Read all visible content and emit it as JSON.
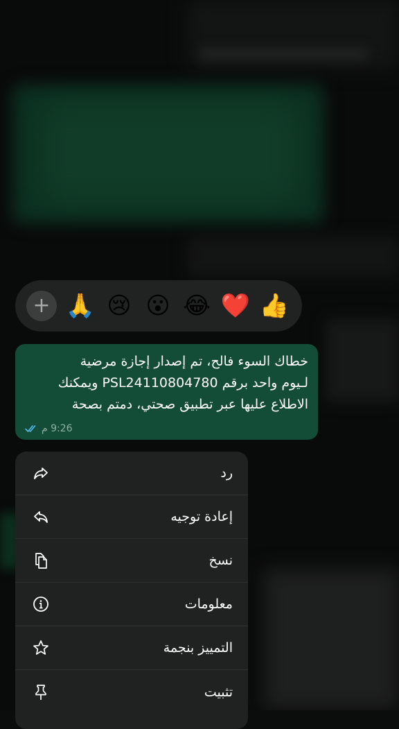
{
  "reactions": {
    "add_symbol": "+",
    "emojis": [
      {
        "symbol": "🙏",
        "name": "folded-hands"
      },
      {
        "symbol": "😢",
        "name": "crying-face"
      },
      {
        "symbol": "😮",
        "name": "surprised-face"
      },
      {
        "symbol": "😂",
        "name": "tears-of-joy"
      },
      {
        "symbol": "❤️",
        "name": "red-heart"
      },
      {
        "symbol": "👍",
        "name": "thumbs-up"
      }
    ]
  },
  "message": {
    "lines": [
      "خطاك السوء فالح، تم إصدار إجازة مرضية",
      "لـيوم واحد برقم  PSL24110804780 ويمكنك",
      "الاطلاع عليها عبر تطبيق صحتي، دمتم بصحة"
    ],
    "time": "9:26 م",
    "status": "read",
    "bubble_color": "#144d37",
    "tick_color": "#53bdeb"
  },
  "menu": {
    "items": [
      {
        "label": "رد",
        "icon": "reply-icon"
      },
      {
        "label": "إعادة توجيه",
        "icon": "forward-icon"
      },
      {
        "label": "نسخ",
        "icon": "copy-icon"
      },
      {
        "label": "معلومات",
        "icon": "info-icon"
      },
      {
        "label": "التمييز بنجمة",
        "icon": "star-icon"
      },
      {
        "label": "تثبيت",
        "icon": "pin-icon"
      }
    ]
  }
}
